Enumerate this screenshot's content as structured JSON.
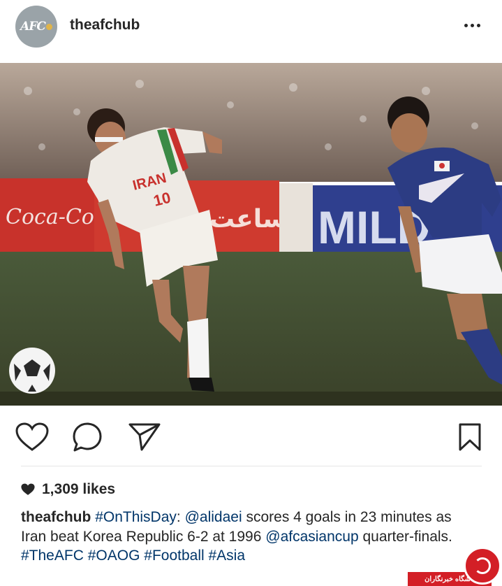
{
  "post": {
    "account": {
      "avatar_text": "AFC",
      "username": "theafchub",
      "more_icon": "more-horizontal-icon"
    },
    "photo": {
      "jersey_text": "IRAN",
      "ad_board_1": "Coca-Cola",
      "ad_board_2": "ساعت",
      "ad_board_3": "MILD"
    },
    "actions": {
      "like_icon": "heart-outline-icon",
      "comment_icon": "comment-bubble-icon",
      "share_icon": "paper-plane-icon",
      "save_icon": "bookmark-icon"
    },
    "likes": {
      "icon": "heart-filled-icon",
      "count_text": "1,309 likes"
    },
    "caption": {
      "author": "theafchub",
      "hashtag_1": "#OnThisDay",
      "colon": ":",
      "mention_1": "@alidaei",
      "text_1": "scores 4 goals in 23 minutes as Iran beat Korea Republic 6-2 at 1996",
      "mention_2": "@afcasiancup",
      "text_2": "quarter-finals.",
      "hashtags": [
        "#TheAFC",
        "#OAOG",
        "#Football",
        "#Asia"
      ]
    },
    "watermark": {
      "label": "باشگاه خبرنگاران"
    },
    "colors": {
      "link": "#003569",
      "text": "#262626",
      "watermark": "#d31f26"
    }
  }
}
